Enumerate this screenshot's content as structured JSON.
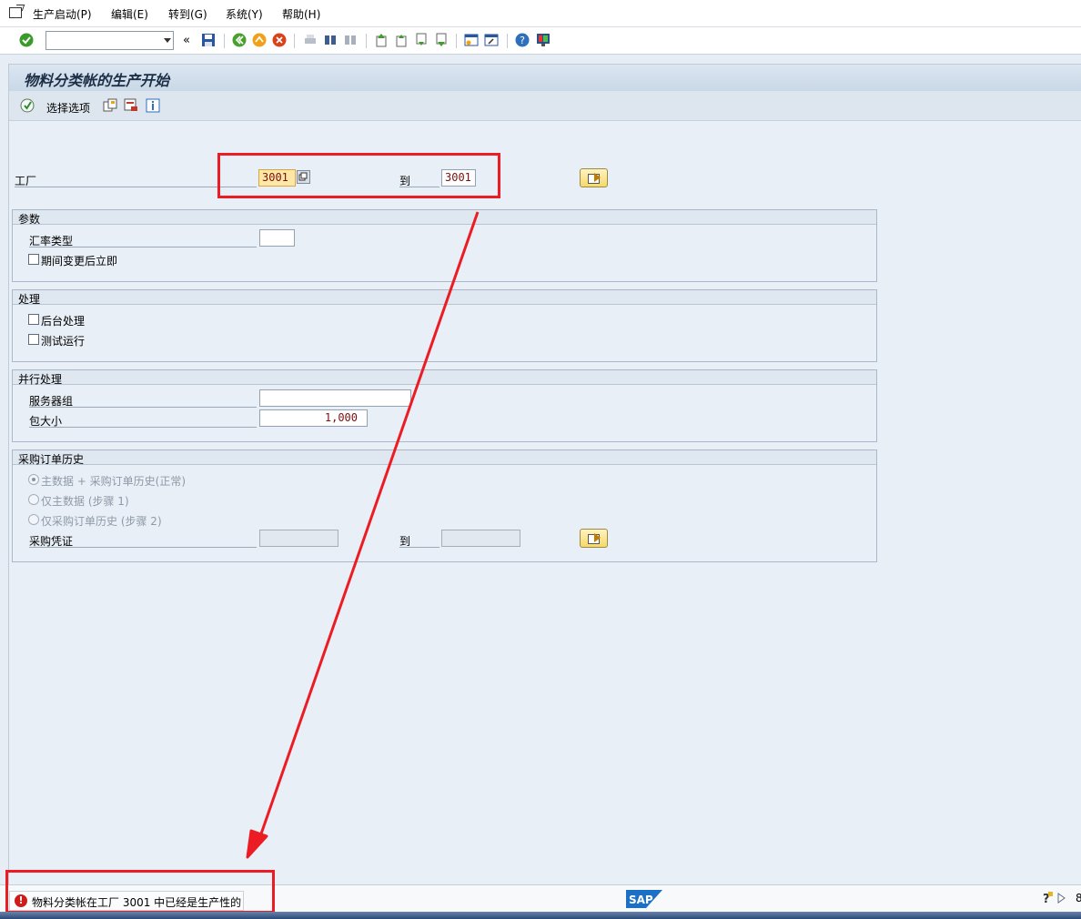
{
  "menu": {
    "items": [
      "生产启动(P)",
      "编辑(E)",
      "转到(G)",
      "系统(Y)",
      "帮助(H)"
    ]
  },
  "toolbar": {
    "command_value": ""
  },
  "title": "物料分类帐的生产开始",
  "appbar": {
    "selection_options_label": "选择选项"
  },
  "plant": {
    "label": "工厂",
    "from": "3001",
    "to_label": "到",
    "to": "3001"
  },
  "params": {
    "title": "参数",
    "rate_type_label": "汇率类型",
    "rate_type_value": "",
    "immediate_label": "期间变更后立即"
  },
  "processing": {
    "title": "处理",
    "background_label": "后台处理",
    "test_run_label": "测试运行"
  },
  "parallel": {
    "title": "并行处理",
    "server_group_label": "服务器组",
    "server_group_value": "",
    "package_size_label": "包大小",
    "package_size_value": "1,000"
  },
  "po_history": {
    "title": "采购订单历史",
    "opt1": "主数据 + 采购订单历史(正常)",
    "opt2": "仅主数据 (步骤 1)",
    "opt3": "仅采购订单历史 (步骤 2)",
    "doc_label": "采购凭证",
    "to_label": "到",
    "doc_from": "",
    "doc_to": ""
  },
  "status": {
    "message": "物料分类帐在工厂 3001 中已经是生产性的",
    "right_char": "8"
  },
  "colors": {
    "annotation_red": "#ec1c24",
    "error_red": "#d01b1b",
    "background": "#e9eff6"
  }
}
